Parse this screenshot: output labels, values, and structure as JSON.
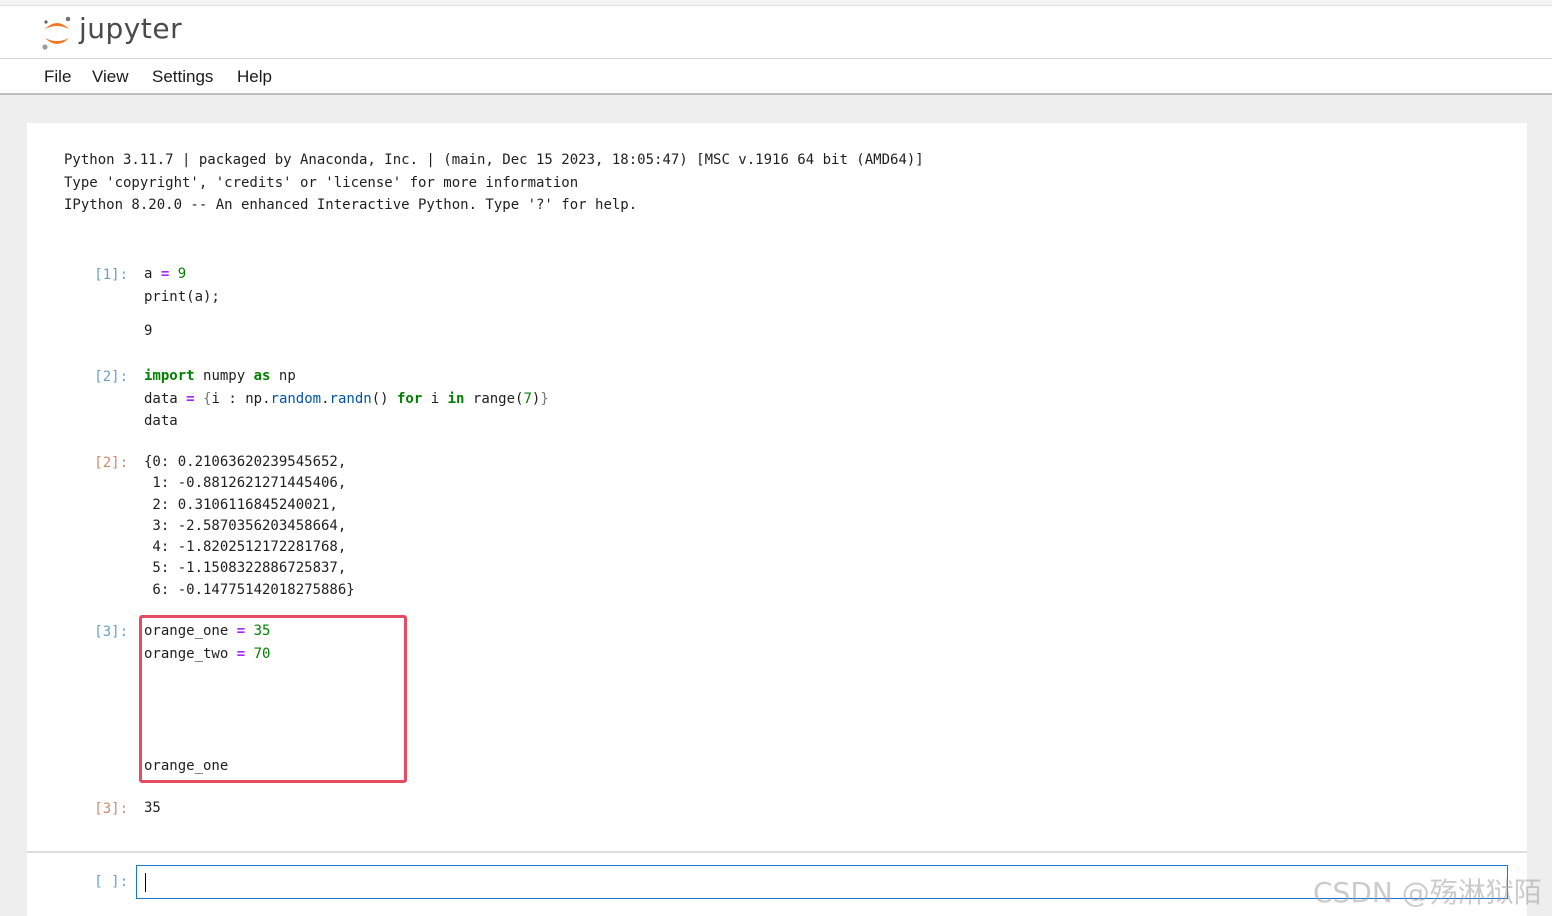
{
  "app": {
    "logo_text": "jupyter"
  },
  "menu": {
    "items": [
      "File",
      "View",
      "Settings",
      "Help"
    ]
  },
  "banner": {
    "lines": [
      "Python 3.11.7 | packaged by Anaconda, Inc. | (main, Dec 15 2023, 18:05:47) [MSC v.1916 64 bit (AMD64)]",
      "Type 'copyright', 'credits' or 'license' for more information",
      "IPython 8.20.0 -- An enhanced Interactive Python. Type '?' for help."
    ]
  },
  "cells": [
    {
      "in_prompt": "[1]:",
      "code_tokens": {
        "l1_var": "a",
        "l1_op": "=",
        "l1_num": "9",
        "l2": "print(a);"
      },
      "stdout": "9"
    },
    {
      "in_prompt": "[2]:",
      "code_tokens": {
        "l1_kw1": "import",
        "l1_mod": "numpy",
        "l1_kw2": "as",
        "l1_alias": "np",
        "l2_var": "data",
        "l2_op": "=",
        "l2_brace_open": "{",
        "l2_i": "i",
        "l2_colon": ":",
        "l2_np": "np.",
        "l2_random": "random",
        "l2_dot": ".",
        "l2_randn": "randn",
        "l2_paren": "()",
        "l2_for": "for",
        "l2_i2": "i",
        "l2_in": "in",
        "l2_range": "range(",
        "l2_seven": "7",
        "l2_close": ")",
        "l2_brace_close": "}",
        "l3": "data"
      },
      "out_prompt": "[2]:",
      "output_lines": [
        "{0: 0.21063620239545652,",
        " 1: -0.8812621271445406,",
        " 2: 0.3106116845240021,",
        " 3: -2.5870356203458664,",
        " 4: -1.8202512172281768,",
        " 5: -1.1508322886725837,",
        " 6: -0.14775142018275886}"
      ]
    },
    {
      "in_prompt": "[3]:",
      "code_tokens": {
        "l1_var": "orange_one",
        "l1_op": "=",
        "l1_num": "35",
        "l2_var": "orange_two",
        "l2_op": "=",
        "l2_num": "70",
        "l3": "orange_one"
      },
      "out_prompt": "[3]:",
      "output": "35"
    }
  ],
  "new_cell": {
    "prompt": "[ ]:",
    "value": ""
  },
  "watermark": "CSDN @殇淋狱陌",
  "colors": {
    "highlight_border": "#e84a62",
    "active_input_border": "#1976d2"
  }
}
